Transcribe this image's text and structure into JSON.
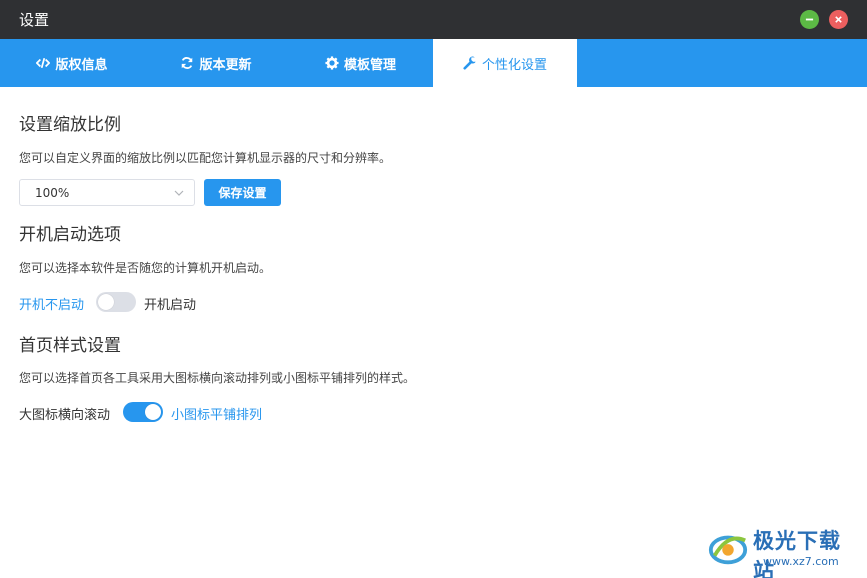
{
  "window": {
    "title": "设置"
  },
  "tabs": [
    {
      "label": "版权信息",
      "icon": "code-icon"
    },
    {
      "label": "版本更新",
      "icon": "refresh-icon"
    },
    {
      "label": "模板管理",
      "icon": "gear-icon"
    },
    {
      "label": "个性化设置",
      "icon": "wrench-icon",
      "active": true
    }
  ],
  "scale": {
    "heading": "设置缩放比例",
    "desc": "您可以自定义界面的缩放比例以匹配您计算机显示器的尺寸和分辨率。",
    "value": "100%",
    "save_label": "保存设置"
  },
  "startup": {
    "heading": "开机启动选项",
    "desc": "您可以选择本软件是否随您的计算机开机启动。",
    "off_label": "开机不启动",
    "on_label": "开机启动",
    "enabled": false
  },
  "homepage": {
    "heading": "首页样式设置",
    "desc": "您可以选择首页各工具采用大图标横向滚动排列或小图标平铺排列的样式。",
    "left_label": "大图标横向滚动",
    "right_label": "小图标平铺排列",
    "small_icons": true
  },
  "watermark": {
    "name": "极光下载站",
    "url": "www.xz7.com"
  },
  "colors": {
    "accent": "#2796ee",
    "titlebar": "#2f3033",
    "minimize": "#5cb945",
    "close": "#ec5f5f"
  }
}
